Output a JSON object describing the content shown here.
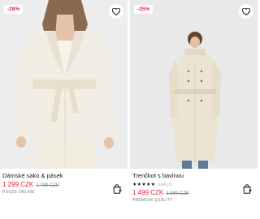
{
  "products": [
    {
      "discount_badge": "-28%",
      "name": "Dámské sako & pásek",
      "price_current": "1 299 CZK",
      "price_original": "1 799 CZK",
      "tag": "POUZE ONLINE",
      "colors": {
        "background": "#ededed",
        "garment": "#f3eee4",
        "sale": "#e0253a"
      },
      "icons": [
        "heart-icon",
        "shopping-bag-icon"
      ]
    },
    {
      "discount_badge": "-25%",
      "name": "Trenčkot s bavlnou",
      "rating_stars": "★★★★★",
      "rating_count": "4,6/5 (7)",
      "rating": 4.6,
      "price_current": "1 499 CZK",
      "price_original": "1 999 CZK",
      "tag": "PREMIUM QUALITY",
      "colors": {
        "background": "#e9e9e9",
        "garment": "#ece4d3",
        "sale": "#e0253a"
      },
      "icons": [
        "heart-icon",
        "shopping-bag-icon"
      ]
    }
  ]
}
